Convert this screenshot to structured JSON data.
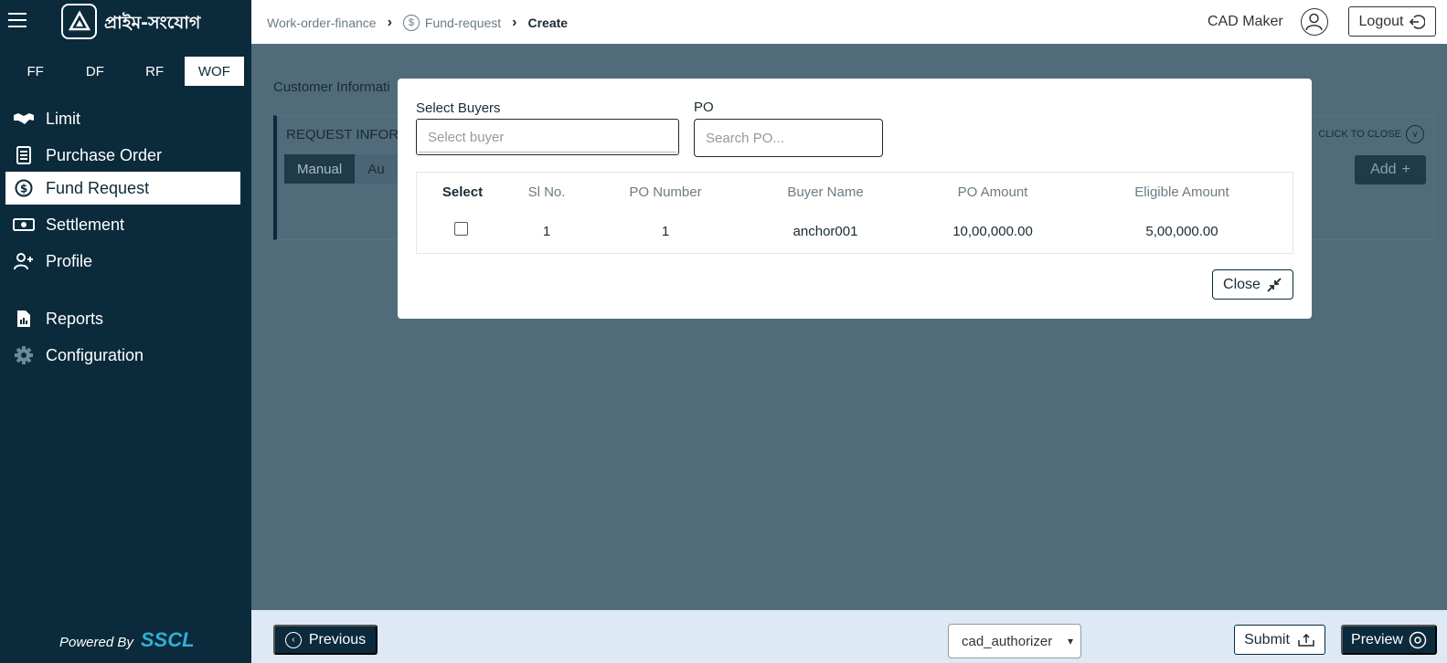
{
  "brand": {
    "name": "প্রাইম-সংযোগ",
    "powered_by": "Powered By",
    "vendor": "SSCL"
  },
  "program_tabs": [
    {
      "label": "FF",
      "active": false
    },
    {
      "label": "DF",
      "active": false
    },
    {
      "label": "RF",
      "active": false
    },
    {
      "label": "WOF",
      "active": true
    }
  ],
  "nav": {
    "limit": "Limit",
    "purchase_order": "Purchase Order",
    "fund_request": "Fund Request",
    "settlement": "Settlement",
    "profile": "Profile",
    "reports": "Reports",
    "configuration": "Configuration"
  },
  "breadcrumb": {
    "item1": "Work-order-finance",
    "item2": "Fund-request",
    "item3": "Create"
  },
  "header": {
    "user": "CAD Maker",
    "logout": "Logout"
  },
  "background": {
    "customer_info": "Customer Informati",
    "request_info": "REQUEST INFORM",
    "click_to_close": "CLICK TO CLOSE",
    "seg_manual": "Manual",
    "seg_auto": "Au",
    "add": "Add"
  },
  "modal": {
    "buyers_label": "Select Buyers",
    "buyers_placeholder": "Select buyer",
    "po_label": "PO",
    "po_placeholder": "Search PO...",
    "columns": [
      "Select",
      "Sl No.",
      "PO Number",
      "Buyer Name",
      "PO Amount",
      "Eligible Amount"
    ],
    "rows": [
      {
        "sl": "1",
        "po_number": "1",
        "buyer": "anchor001",
        "po_amount": "10,00,000.00",
        "eligible": "5,00,000.00",
        "checked": false
      }
    ],
    "close": "Close"
  },
  "footer": {
    "previous": "Previous",
    "role": "cad_authorizer",
    "submit": "Submit",
    "preview": "Preview"
  },
  "colors": {
    "sidebar": "#0b2a3b",
    "overlay": "#506c7b",
    "footer": "#dde9f4",
    "accent": "#2fb0d8"
  }
}
